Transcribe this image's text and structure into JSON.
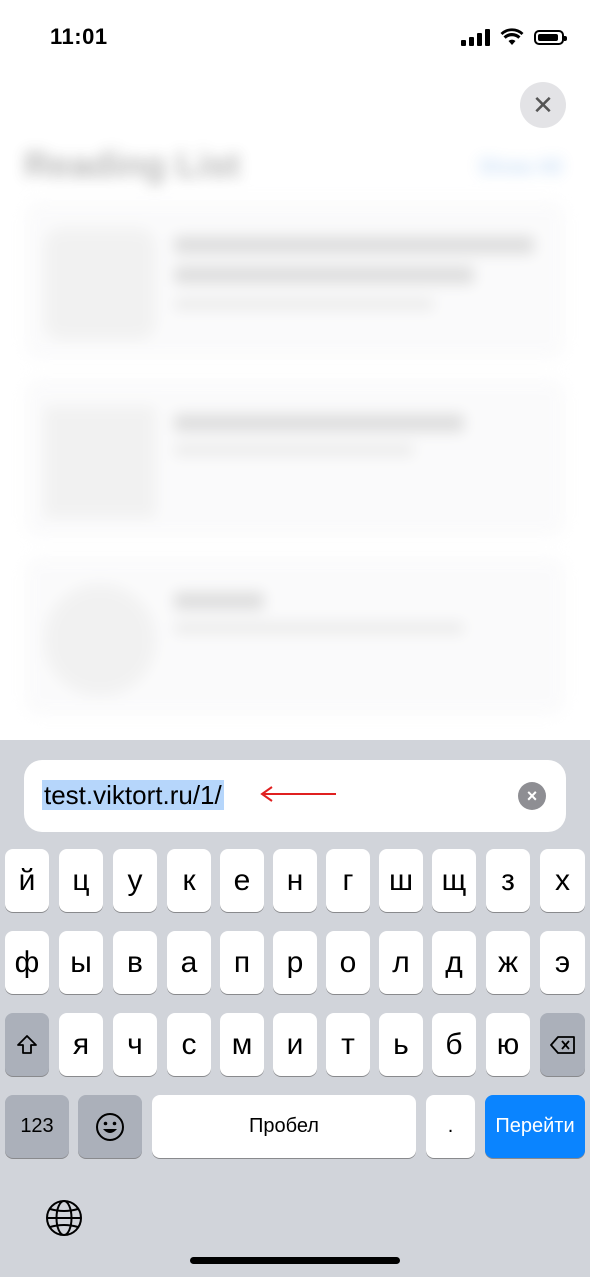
{
  "status": {
    "time": "11:01"
  },
  "background": {
    "title": "Reading List",
    "show_all": "Show All"
  },
  "address_bar": {
    "url": "test.viktort.ru/1/"
  },
  "keyboard": {
    "row1": [
      "й",
      "ц",
      "у",
      "к",
      "е",
      "н",
      "г",
      "ш",
      "щ",
      "з",
      "х"
    ],
    "row2": [
      "ф",
      "ы",
      "в",
      "а",
      "п",
      "р",
      "о",
      "л",
      "д",
      "ж",
      "э"
    ],
    "row3": [
      "я",
      "ч",
      "с",
      "м",
      "и",
      "т",
      "ь",
      "б",
      "ю"
    ],
    "numbers_label": "123",
    "space_label": "Пробел",
    "period_label": ".",
    "go_label": "Перейти"
  },
  "colors": {
    "accent": "#0a84ff",
    "keyboard_bg": "#d1d4da",
    "selection": "#b6d6fb",
    "arrow": "#e02020"
  }
}
